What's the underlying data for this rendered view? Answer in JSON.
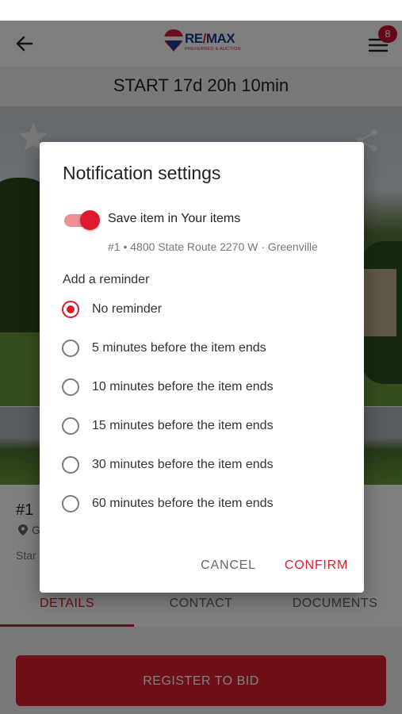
{
  "header": {
    "notification_count": "8"
  },
  "timer": {
    "label": "START 17d 20h 10min"
  },
  "logo": {
    "wordmark_left": "RE",
    "wordmark_slash": "/",
    "wordmark_right": "MAX",
    "tagline": "PREFERRED & AUCTION"
  },
  "item": {
    "lot": "#1",
    "location": "G",
    "start": "Star"
  },
  "tabs": [
    {
      "label": "DETAILS",
      "active": true
    },
    {
      "label": "CONTACT",
      "active": false
    },
    {
      "label": "DOCUMENTS",
      "active": false
    }
  ],
  "register_button": {
    "label": "REGISTER TO BID"
  },
  "dialog": {
    "title": "Notification settings",
    "save_toggle": {
      "label": "Save item in Your items",
      "on": true
    },
    "item_description": "#1 • 4800 State Route 2270 W · Greenville",
    "reminder_heading": "Add a reminder",
    "options": [
      {
        "label": "No reminder",
        "selected": true
      },
      {
        "label": "5 minutes before the item ends",
        "selected": false
      },
      {
        "label": "10 minutes before the item ends",
        "selected": false
      },
      {
        "label": "15 minutes before the item ends",
        "selected": false
      },
      {
        "label": "30 minutes before the item ends",
        "selected": false
      },
      {
        "label": "60 minutes before the item ends",
        "selected": false
      }
    ],
    "cancel_label": "CANCEL",
    "confirm_label": "CONFIRM"
  },
  "colors": {
    "accent": "#dc1c2e",
    "brand_blue": "#1a3d8f",
    "scrim": "rgba(0,0,0,0.5)"
  },
  "icons": [
    "back-arrow-icon",
    "hamburger-menu-icon",
    "star-icon",
    "share-icon",
    "location-pin-icon"
  ]
}
